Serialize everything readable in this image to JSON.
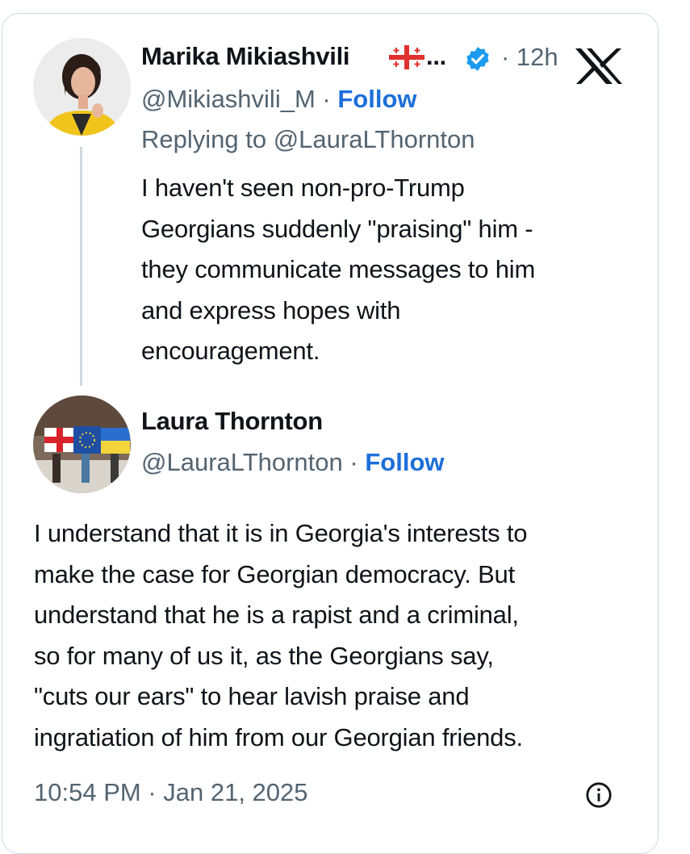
{
  "post": {
    "author_name": "Marika Mikiashvili",
    "name_ellipsis": "...",
    "handle": "@Mikiashvili_M",
    "separator": "·",
    "follow_label": "Follow",
    "time_ago": "· 12h",
    "replying_to": "Replying to @LauraLThornton",
    "text": "I haven't seen non-pro-Trump\nGeorgians suddenly \"praising\" him -\nthey communicate messages to him\nand express hopes with\nencouragement."
  },
  "reply": {
    "author_name": "Laura Thornton",
    "handle": "@LauraLThornton",
    "separator": "·",
    "follow_label": "Follow",
    "text": "I understand that it is in Georgia's interests to\nmake the case for Georgian democracy. But\nunderstand that he is a rapist and a criminal,\nso for many of us it, as the Georgians say,\n\"cuts our ears\" to hear lavish praise and\ningratiation of him from our Georgian friends.",
    "timestamp": "10:54 PM · Jan 21, 2025"
  },
  "icons": {
    "flag": "georgia-flag-icon",
    "verified": "verified-badge-icon",
    "logo": "x-logo-icon",
    "info": "info-icon"
  },
  "colors": {
    "follow": "#1d6fd9",
    "verified": "#1d9bf0",
    "muted_text": "#536471",
    "border": "#cfd9de"
  }
}
